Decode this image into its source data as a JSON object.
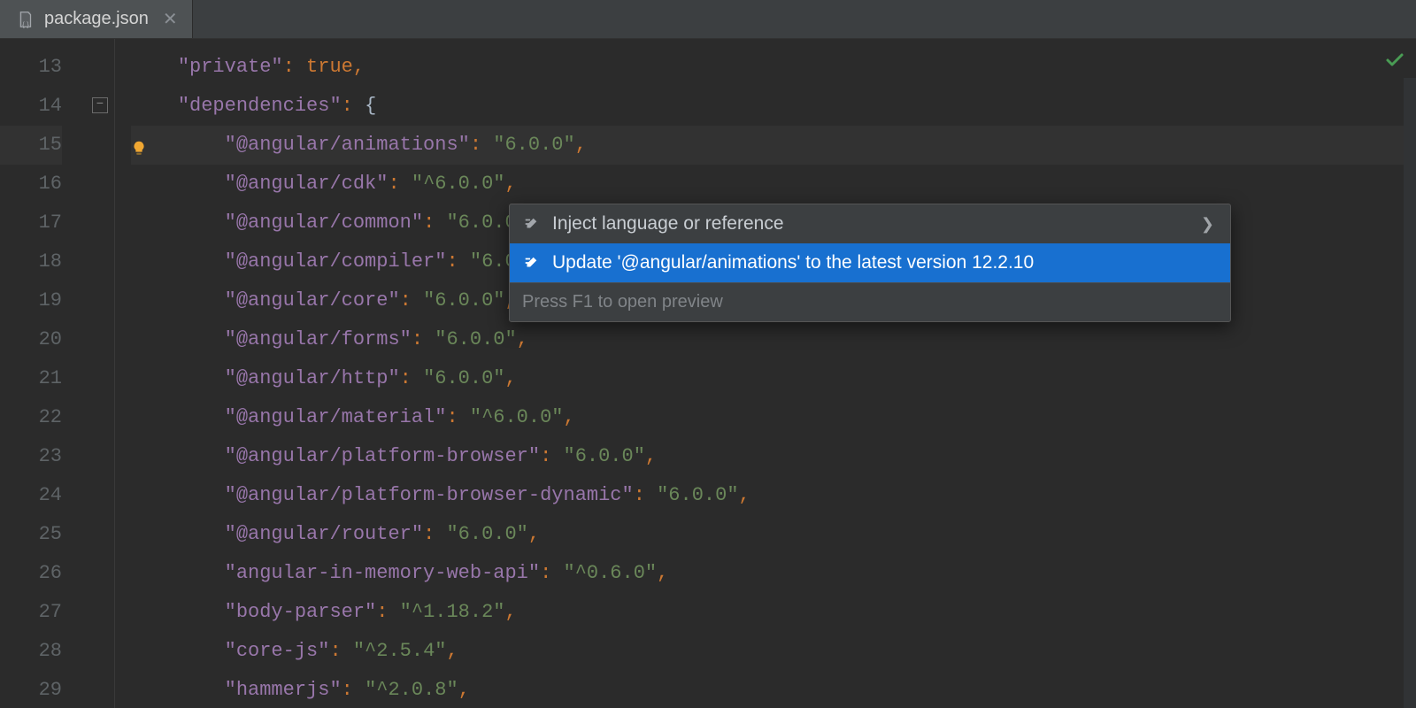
{
  "tab": {
    "filename": "package.json"
  },
  "gutter": {
    "start": 13,
    "end": 29,
    "highlight": 15
  },
  "fold": {
    "line": 14
  },
  "code": {
    "lines": [
      {
        "n": 13,
        "indent": "    ",
        "key": "\"private\"",
        "colon": ": ",
        "val": "true",
        "valClass": "val-lit",
        "comma": ","
      },
      {
        "n": 14,
        "indent": "    ",
        "key": "\"dependencies\"",
        "colon": ": ",
        "brace": "{"
      },
      {
        "n": 15,
        "indent": "        ",
        "key": "\"@angular/animations\"",
        "colon": ": ",
        "val": "\"6.0.0\"",
        "valClass": "val-str",
        "comma": ",",
        "bulb": true,
        "hl": true
      },
      {
        "n": 16,
        "indent": "        ",
        "key": "\"@angular/cdk\"",
        "colon": ": ",
        "val": "\"^6.0.0\"",
        "valClass": "val-str",
        "comma": ","
      },
      {
        "n": 17,
        "indent": "        ",
        "key": "\"@angular/common\"",
        "colon": ": ",
        "val": "\"6.0.0\"",
        "valClass": "val-str",
        "comma": ","
      },
      {
        "n": 18,
        "indent": "        ",
        "key": "\"@angular/compiler\"",
        "colon": ": ",
        "val": "\"6.0.0\"",
        "valClass": "val-str",
        "comma": ","
      },
      {
        "n": 19,
        "indent": "        ",
        "key": "\"@angular/core\"",
        "colon": ": ",
        "val": "\"6.0.0\"",
        "valClass": "val-str",
        "comma": ","
      },
      {
        "n": 20,
        "indent": "        ",
        "key": "\"@angular/forms\"",
        "colon": ": ",
        "val": "\"6.0.0\"",
        "valClass": "val-str",
        "comma": ","
      },
      {
        "n": 21,
        "indent": "        ",
        "key": "\"@angular/http\"",
        "colon": ": ",
        "val": "\"6.0.0\"",
        "valClass": "val-str",
        "comma": ","
      },
      {
        "n": 22,
        "indent": "        ",
        "key": "\"@angular/material\"",
        "colon": ": ",
        "val": "\"^6.0.0\"",
        "valClass": "val-str",
        "comma": ","
      },
      {
        "n": 23,
        "indent": "        ",
        "key": "\"@angular/platform-browser\"",
        "colon": ": ",
        "val": "\"6.0.0\"",
        "valClass": "val-str",
        "comma": ","
      },
      {
        "n": 24,
        "indent": "        ",
        "key": "\"@angular/platform-browser-dynamic\"",
        "colon": ": ",
        "val": "\"6.0.0\"",
        "valClass": "val-str",
        "comma": ","
      },
      {
        "n": 25,
        "indent": "        ",
        "key": "\"@angular/router\"",
        "colon": ": ",
        "val": "\"6.0.0\"",
        "valClass": "val-str",
        "comma": ","
      },
      {
        "n": 26,
        "indent": "        ",
        "key": "\"angular-in-memory-web-api\"",
        "colon": ": ",
        "val": "\"^0.6.0\"",
        "valClass": "val-str",
        "comma": ","
      },
      {
        "n": 27,
        "indent": "        ",
        "key": "\"body-parser\"",
        "colon": ": ",
        "val": "\"^1.18.2\"",
        "valClass": "val-str",
        "comma": ","
      },
      {
        "n": 28,
        "indent": "        ",
        "key": "\"core-js\"",
        "colon": ": ",
        "val": "\"^2.5.4\"",
        "valClass": "val-str",
        "comma": ","
      },
      {
        "n": 29,
        "indent": "        ",
        "key": "\"hammerjs\"",
        "colon": ": ",
        "val": "\"^2.0.8\"",
        "valClass": "val-str",
        "comma": ","
      }
    ]
  },
  "popup": {
    "items": [
      {
        "label": "Inject language or reference",
        "selected": false,
        "submenu": true
      },
      {
        "label": "Update '@angular/animations' to the latest version 12.2.10",
        "selected": true,
        "submenu": false
      }
    ],
    "footer": "Press F1 to open preview"
  }
}
